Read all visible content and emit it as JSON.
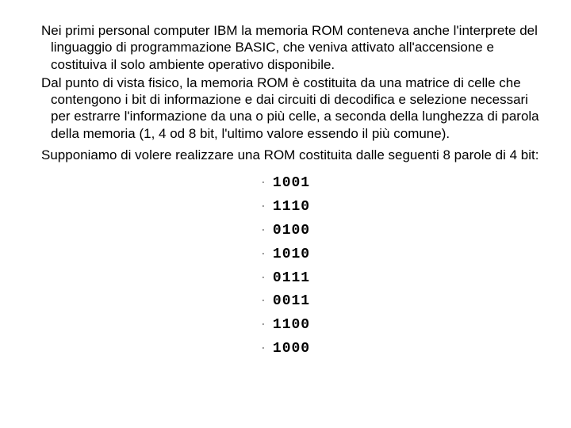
{
  "paragraphs": {
    "p1": "Nei primi personal computer IBM la memoria ROM conteneva anche l'interprete del linguaggio di programmazione BASIC, che veniva attivato all'accensione e costituiva il solo ambiente operativo disponibile.",
    "p2": "Dal punto di vista fisico, la memoria ROM è costituita da una matrice di celle che contengono i bit di informazione e dai circuiti di decodifica e selezione necessari per estrarre l'informazione da una o più celle, a seconda della lunghezza di parola della memoria (1, 4 od 8 bit, l'ultimo valore essendo il più comune).",
    "p3": "Supponiamo di volere realizzare una ROM costituita dalle seguenti 8 parole di 4 bit:"
  },
  "rom_words": [
    "1001",
    "1110",
    "0100",
    "1010",
    "0111",
    "0011",
    "1100",
    "1000"
  ]
}
